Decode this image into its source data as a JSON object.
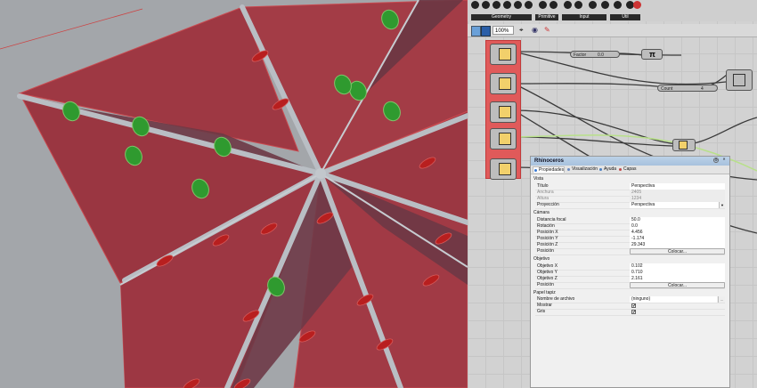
{
  "ribbon": {
    "groups": [
      {
        "label": "Geometry",
        "color": "#2a2a2a"
      },
      {
        "label": "Primitive",
        "color": "#2a2a2a"
      },
      {
        "label": "Input",
        "color": "#2a2a2a"
      },
      {
        "label": "Util",
        "color": "#2a2a2a"
      }
    ]
  },
  "toolbar": {
    "zoom_value": "100%",
    "icons": [
      "open-file-icon",
      "save-file-icon",
      "zoom-extents-icon",
      "preview-eye-icon",
      "sketch-pen-icon"
    ]
  },
  "canvas": {
    "slider_factor": {
      "label": "Factor",
      "value": "0.0"
    },
    "slider_count": {
      "label": "Count",
      "value": "4"
    },
    "pi_label": "π",
    "component_groups": [
      {
        "name": "component-1"
      },
      {
        "name": "component-2"
      },
      {
        "name": "component-3"
      },
      {
        "name": "component-4"
      },
      {
        "name": "component-5"
      }
    ],
    "group_color": "#e05a5a"
  },
  "panel": {
    "title": "Rhinoceros",
    "tabs": [
      {
        "label": "Propiedades",
        "color": "#3a7bd5"
      },
      {
        "label": "Visualización",
        "color": "#6a8ac0"
      },
      {
        "label": "Ayuda",
        "color": "#4a7fc0"
      },
      {
        "label": "Capas",
        "color": "#c04a4a"
      }
    ],
    "sections": {
      "vista": "Vista",
      "camara": "Cámara",
      "objetivo": "Objetivo",
      "papel": "Papel tapiz"
    },
    "vista_rows": [
      {
        "key": "Título",
        "value": "Perspectiva",
        "disabled": false
      },
      {
        "key": "Anchura",
        "value": "2405",
        "disabled": true
      },
      {
        "key": "Altura",
        "value": "1234",
        "disabled": true
      },
      {
        "key": "Proyección",
        "value": "Perspectiva",
        "disabled": false,
        "dropdown": true
      }
    ],
    "camara_rows": [
      {
        "key": "Distancia focal",
        "value": "50.0"
      },
      {
        "key": "Rotación",
        "value": "0.0"
      },
      {
        "key": "Posición X",
        "value": "4.456"
      },
      {
        "key": "Posición Y",
        "value": "-1.174"
      },
      {
        "key": "Posición Z",
        "value": "29.343"
      }
    ],
    "camara_posicion": {
      "key": "Posición",
      "button": "Colocar..."
    },
    "objetivo_rows": [
      {
        "key": "Objetivo X",
        "value": "0.102"
      },
      {
        "key": "Objetivo Y",
        "value": "0.710"
      },
      {
        "key": "Objetivo Z",
        "value": "2.161"
      }
    ],
    "objetivo_posicion": {
      "key": "Posición",
      "button": "Colocar..."
    },
    "papel_rows": [
      {
        "key": "Nombre de archivo",
        "value": "(ninguno)",
        "browse": "..."
      },
      {
        "key": "Mostrar",
        "checked": true
      },
      {
        "key": "Gris",
        "checked": true
      }
    ]
  },
  "viewport": {
    "background": "#a3a6aa",
    "panel_fill": "#a23b44",
    "dark_fill": "#6e3a47",
    "strut_color": "#b9bec4",
    "marker_green": "#2f9a2f",
    "marker_red": "#b81f1f"
  }
}
